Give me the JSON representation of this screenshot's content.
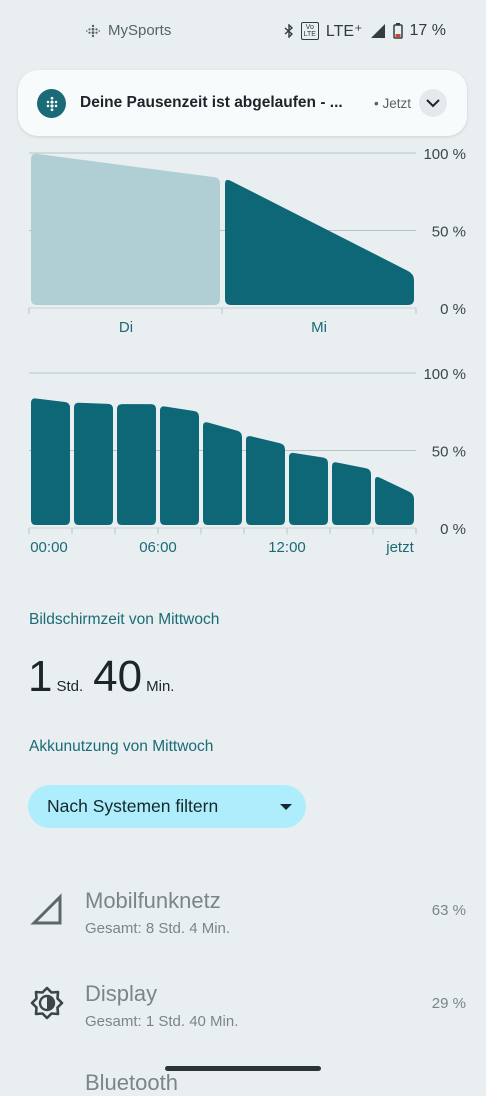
{
  "status_bar": {
    "app_name": "MySports",
    "network": "LTE⁺",
    "volte_top": "Vo",
    "volte_bottom": "LTE",
    "battery": "17 %"
  },
  "notification": {
    "text": "Deine Pausenzeit ist abgelaufen - ...",
    "time": "• Jetzt",
    "accent_color": "#1a6a77"
  },
  "chart_data": [
    {
      "type": "area",
      "title": "",
      "y_ticks": [
        "100 %",
        "50 %",
        "0 %"
      ],
      "categories": [
        "Di",
        "Mi"
      ],
      "ylim": [
        0,
        100
      ],
      "grid": true,
      "series": [
        {
          "segment": "Di",
          "color": "#afcfd4",
          "start_pct": 98,
          "end_pct": 82
        },
        {
          "segment": "Mi",
          "color": "#0e6776",
          "start_pct": 82,
          "end_pct": 20
        }
      ]
    },
    {
      "type": "bar",
      "title": "",
      "y_ticks": [
        "100 %",
        "50 %",
        "0 %"
      ],
      "x_ticks": [
        "00:00",
        "06:00",
        "12:00",
        "jetzt"
      ],
      "ylim": [
        0,
        100
      ],
      "grid": true,
      "color": "#0e6776",
      "bars": [
        {
          "start_pct": 82,
          "end_pct": 79
        },
        {
          "start_pct": 79,
          "end_pct": 78
        },
        {
          "start_pct": 78,
          "end_pct": 78
        },
        {
          "start_pct": 77,
          "end_pct": 73
        },
        {
          "start_pct": 67,
          "end_pct": 60
        },
        {
          "start_pct": 58,
          "end_pct": 52
        },
        {
          "start_pct": 47,
          "end_pct": 43
        },
        {
          "start_pct": 41,
          "end_pct": 36
        },
        {
          "start_pct": 32,
          "end_pct": 20
        }
      ]
    }
  ],
  "screen_time": {
    "title": "Bildschirmzeit von Mittwoch",
    "hours": "1",
    "hours_unit": "Std.",
    "minutes": "40",
    "minutes_unit": "Min."
  },
  "battery_usage": {
    "title": "Akkunutzung von Mittwoch",
    "filter_label": "Nach Systemen filtern",
    "items": [
      {
        "name": "Mobilfunknetz",
        "detail": "Gesamt: 8 Std. 4 Min.",
        "percent": "63 %",
        "icon": "cellular-signal-icon"
      },
      {
        "name": "Display",
        "detail": "Gesamt: 1 Std. 40 Min.",
        "percent": "29 %",
        "icon": "brightness-icon"
      }
    ],
    "partial_item": "Bluetooth"
  }
}
